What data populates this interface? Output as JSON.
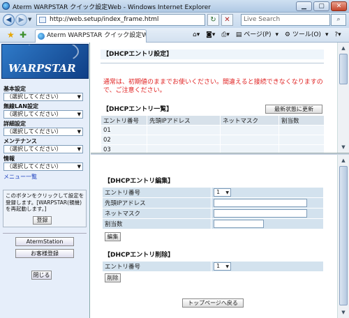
{
  "window": {
    "title": "Aterm WARPSTAR クイック設定Web - Windows Internet Explorer"
  },
  "addressbar": {
    "url": "http://web.setup/index_frame.html",
    "search_placeholder": "Live Search"
  },
  "tab": {
    "label": "Aterm WARPSTAR クイック設定Web"
  },
  "toolbar": {
    "page": "ページ(P)",
    "tools": "ツール(O)"
  },
  "sidebar": {
    "logo": "WARPSTAR",
    "groups": [
      {
        "label": "基本設定",
        "selected": "（選択してください）"
      },
      {
        "label": "無線LAN設定",
        "selected": "（選択してください）"
      },
      {
        "label": "詳細設定",
        "selected": "（選択してください）"
      },
      {
        "label": "メンテナンス",
        "selected": "（選択してください）"
      },
      {
        "label": "情報",
        "selected": "（選択してください）"
      }
    ],
    "menu_link": "メニュー一覧",
    "note": "このボタンをクリックして設定を登録します。[WARPSTAR(親機)を再起動します。]",
    "register_button": "登録",
    "aterm_station_button": "AtermStation",
    "customer_register_button": "お客様登録",
    "close_button": "閉じる"
  },
  "top_frame": {
    "title": "【DHCPエントリ設定】",
    "warning": "通常は、初期値のままでお使いください。間違えると接続できなくなりますので、ご注意ください。",
    "list_title": "【DHCPエントリ一覧】",
    "refresh_button": "最新状態に更新",
    "columns": [
      "エントリ番号",
      "先頭IPアドレス",
      "ネットマスク",
      "割当数"
    ],
    "rows": [
      [
        "01",
        "",
        "",
        ""
      ],
      [
        "02",
        "",
        "",
        ""
      ],
      [
        "03",
        "",
        "",
        ""
      ]
    ]
  },
  "bottom_frame": {
    "edit_title": "【DHCPエントリ編集】",
    "edit_fields": [
      {
        "label": "エントリ番号",
        "value": "1"
      },
      {
        "label": "先頭IPアドレス",
        "value": ""
      },
      {
        "label": "ネットマスク",
        "value": ""
      },
      {
        "label": "割当数",
        "value": ""
      }
    ],
    "edit_button": "編集",
    "delete_title": "【DHCPエントリ削除】",
    "delete_field": {
      "label": "エントリ番号",
      "value": "1"
    },
    "delete_button": "削除",
    "top_page_button": "トップページへ戻る"
  }
}
